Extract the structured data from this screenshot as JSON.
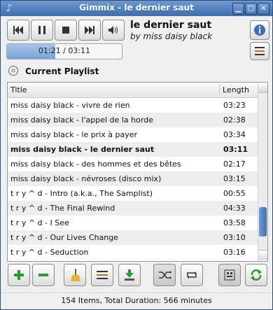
{
  "window": {
    "title": "Gimmix - le dernier saut"
  },
  "player": {
    "time_current": "01:21",
    "time_total": "03:11",
    "time_display": "01:21 / 03:11",
    "progress_fraction": 0.42,
    "song_title": "le dernier saut",
    "song_artist": "by miss daisy black"
  },
  "playlist": {
    "heading": "Current Playlist",
    "columns": {
      "title": "Title",
      "length": "Length"
    },
    "rows": [
      {
        "title": "miss daisy black - vivre de rien",
        "length": "03:23"
      },
      {
        "title": "miss daisy black - l'appel de la horde",
        "length": "02:38"
      },
      {
        "title": "miss daisy black - le prix à payer",
        "length": "03:34"
      },
      {
        "title": "miss daisy black - le dernier saut",
        "length": "03:11",
        "playing": true
      },
      {
        "title": "miss daisy black - des hommes et des bêtes",
        "length": "02:17"
      },
      {
        "title": "miss daisy black - névroses (disco mix)",
        "length": "03:15"
      },
      {
        "title": "t r y ^ d - Intro (a.k.a., The Samplist)",
        "length": "00:55"
      },
      {
        "title": "t r y ^ d - The Final Rewind",
        "length": "04:33"
      },
      {
        "title": "t r y ^ d - I See",
        "length": "03:58"
      },
      {
        "title": "t r y ^ d - Our Lives Change",
        "length": "03:10"
      },
      {
        "title": "t r y ^ d - Seduction",
        "length": "03:16"
      }
    ]
  },
  "status": {
    "text": "154 Items, Total Duration: 566 minutes"
  },
  "colors": {
    "accent": "#4a78b8",
    "progress": "#7aa2d8",
    "add": "#2e9a2e"
  }
}
